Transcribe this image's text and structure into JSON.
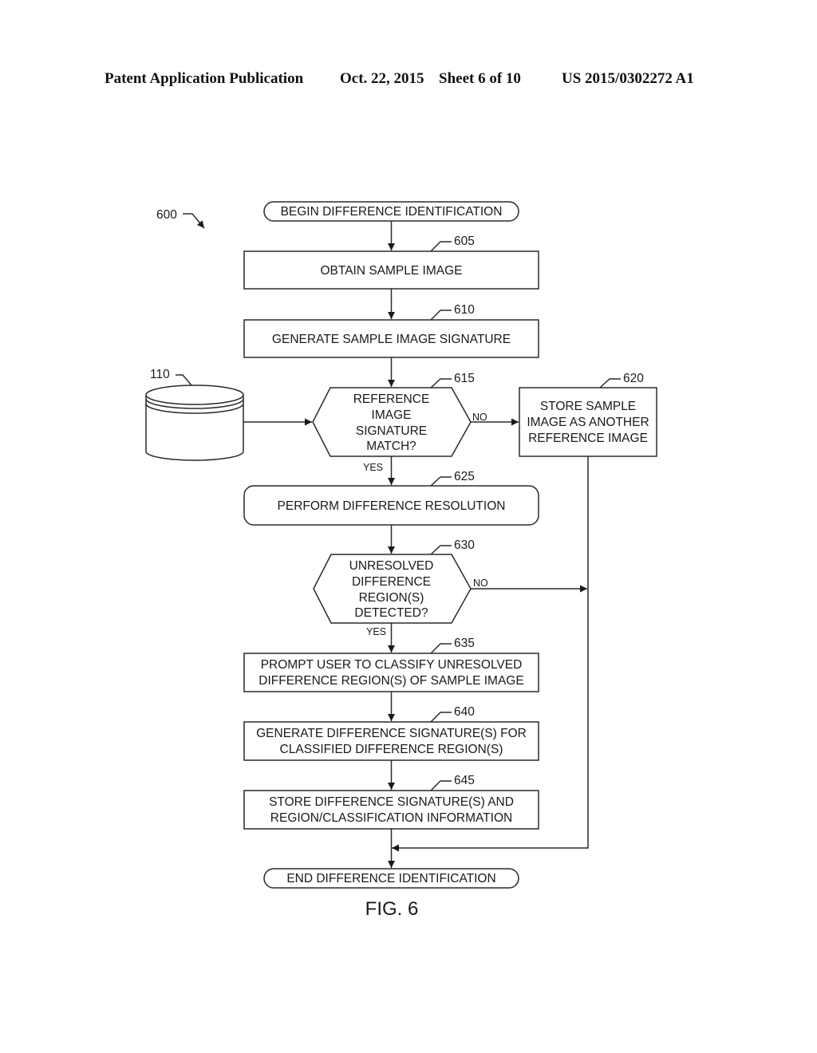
{
  "header": {
    "publication_type": "Patent Application Publication",
    "date": "Oct. 22, 2015",
    "sheet": "Sheet 6 of 10",
    "patent_number": "US 2015/0302272 A1"
  },
  "figure": {
    "label": "FIG. 6",
    "reference_number": "600",
    "database": {
      "reference_number": "110",
      "icon": "database-cylinder-icon"
    },
    "nodes": {
      "begin": {
        "type": "terminator",
        "lines": [
          "BEGIN DIFFERENCE IDENTIFICATION"
        ]
      },
      "n605": {
        "type": "process",
        "ref": "605",
        "lines": [
          "OBTAIN SAMPLE IMAGE"
        ]
      },
      "n610": {
        "type": "process",
        "ref": "610",
        "lines": [
          "GENERATE SAMPLE IMAGE SIGNATURE"
        ]
      },
      "n615": {
        "type": "decision",
        "ref": "615",
        "lines": [
          "REFERENCE",
          "IMAGE",
          "SIGNATURE",
          "MATCH?"
        ]
      },
      "n620": {
        "type": "process",
        "ref": "620",
        "lines": [
          "STORE SAMPLE",
          "IMAGE AS ANOTHER",
          "REFERENCE IMAGE"
        ]
      },
      "n625": {
        "type": "rounded-process",
        "ref": "625",
        "lines": [
          "PERFORM DIFFERENCE RESOLUTION"
        ]
      },
      "n630": {
        "type": "decision",
        "ref": "630",
        "lines": [
          "UNRESOLVED",
          "DIFFERENCE",
          "REGION(S)",
          "DETECTED?"
        ]
      },
      "n635": {
        "type": "process",
        "ref": "635",
        "lines": [
          "PROMPT USER TO CLASSIFY UNRESOLVED",
          "DIFFERENCE REGION(S) OF SAMPLE IMAGE"
        ]
      },
      "n640": {
        "type": "process",
        "ref": "640",
        "lines": [
          "GENERATE DIFFERENCE SIGNATURE(S) FOR",
          "CLASSIFIED DIFFERENCE REGION(S)"
        ]
      },
      "n645": {
        "type": "process",
        "ref": "645",
        "lines": [
          "STORE DIFFERENCE SIGNATURE(S) AND",
          "REGION/CLASSIFICATION INFORMATION"
        ]
      },
      "end": {
        "type": "terminator",
        "lines": [
          "END DIFFERENCE IDENTIFICATION"
        ]
      }
    },
    "edges": [
      {
        "from": "begin",
        "to": "n605",
        "label": ""
      },
      {
        "from": "n605",
        "to": "n610",
        "label": ""
      },
      {
        "from": "n610",
        "to": "n615",
        "label": ""
      },
      {
        "from": "database",
        "to": "n615",
        "label": ""
      },
      {
        "from": "n615",
        "to": "n620",
        "label": "NO"
      },
      {
        "from": "n615",
        "to": "n625",
        "label": "YES"
      },
      {
        "from": "n625",
        "to": "n630",
        "label": ""
      },
      {
        "from": "n630",
        "to": "merge",
        "label": "NO"
      },
      {
        "from": "n630",
        "to": "n635",
        "label": "YES"
      },
      {
        "from": "n635",
        "to": "n640",
        "label": ""
      },
      {
        "from": "n640",
        "to": "n645",
        "label": ""
      },
      {
        "from": "n645",
        "to": "end",
        "label": ""
      },
      {
        "from": "n620",
        "to": "end",
        "label": ""
      }
    ]
  }
}
